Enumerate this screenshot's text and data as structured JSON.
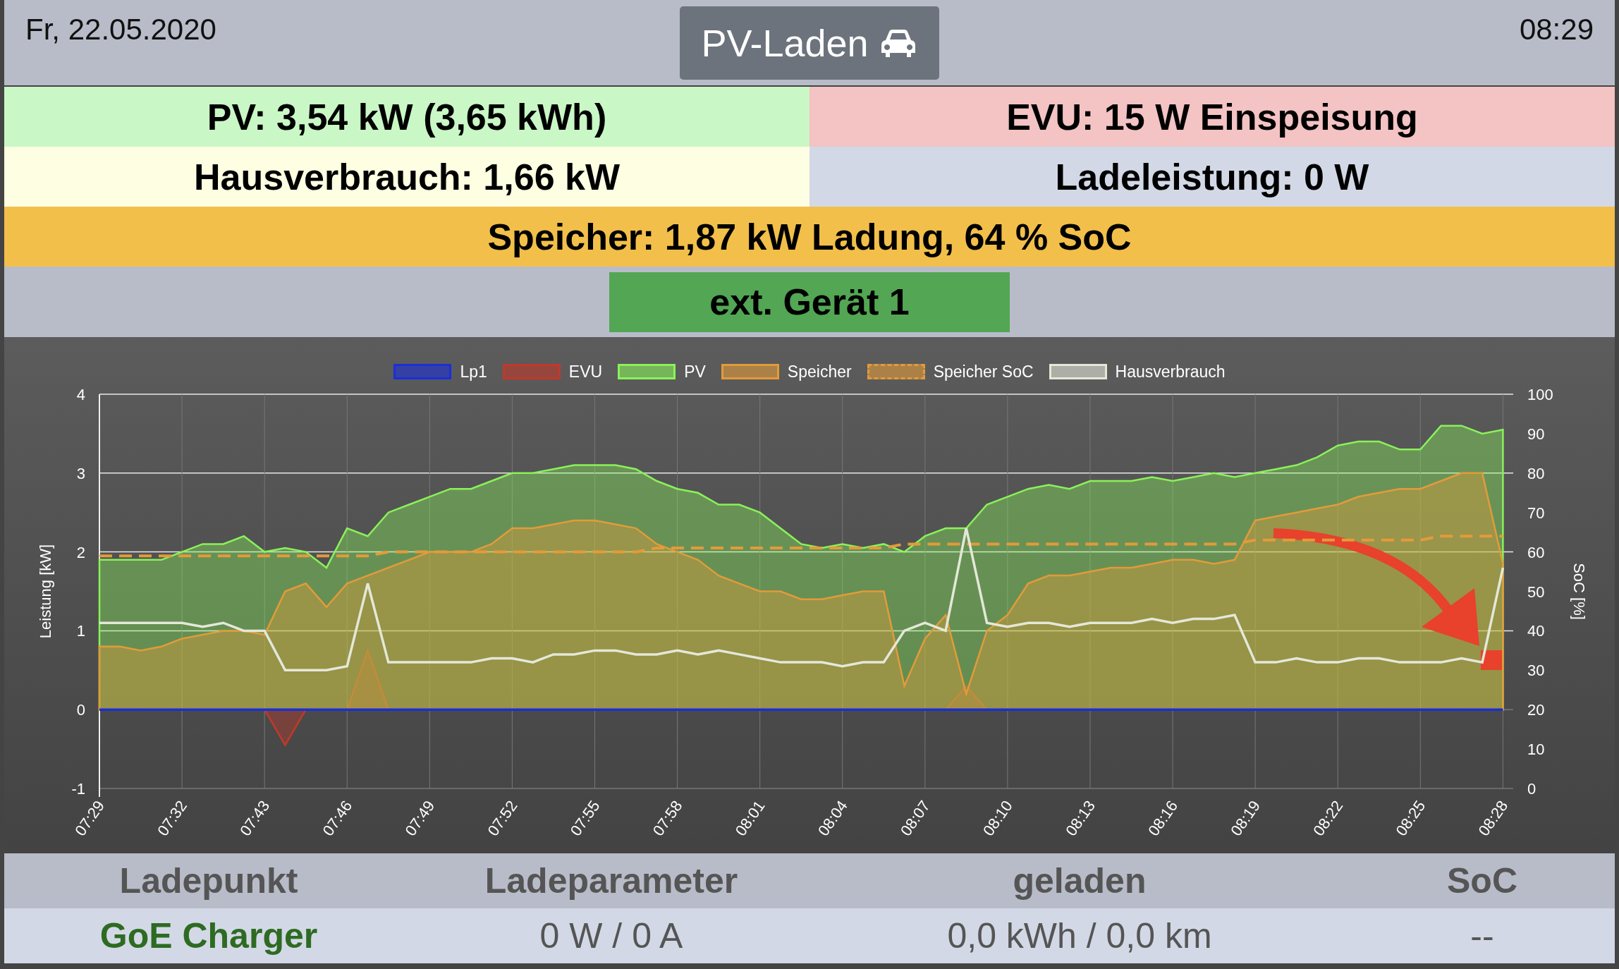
{
  "header": {
    "date": "Fr, 22.05.2020",
    "mode_button": {
      "label": "PV-Laden"
    },
    "time": "08:29"
  },
  "status_rows": [
    {
      "cells": [
        {
          "text": "PV: 3,54 kW (3,65 kWh)",
          "color": "#c9f7c5"
        },
        {
          "text": "EVU: 15 W Einspeisung",
          "color": "#f4c3c3"
        }
      ]
    },
    {
      "cells": [
        {
          "text": "Hausverbrauch: 1,66 kW",
          "color": "#fefee2"
        },
        {
          "text": "Ladeleistung: 0 W",
          "color": "#d3d8e6"
        }
      ]
    },
    {
      "cells": [
        {
          "text": "Speicher: 1,87 kW Ladung, 64 % SoC",
          "color": "#f2bf4a"
        }
      ]
    }
  ],
  "devices": [
    {
      "label": "ext. Gerät 1",
      "on": true
    }
  ],
  "chart": {
    "chart_data": {
      "type": "area",
      "grid": true,
      "legend": true,
      "ylabel": "Leistung [kW]",
      "y2label": "SoC [%]",
      "ylim": [
        -1,
        4
      ],
      "y2lim": [
        0,
        100
      ],
      "yticks": [
        -1,
        0,
        1,
        2,
        3,
        4
      ],
      "y2ticks": [
        0,
        10,
        20,
        30,
        40,
        50,
        60,
        70,
        80,
        90,
        100
      ],
      "categories": [
        "07:29",
        null,
        null,
        null,
        "07:32",
        null,
        null,
        null,
        "07:43",
        null,
        null,
        null,
        "07:46",
        null,
        null,
        null,
        "07:49",
        null,
        null,
        null,
        "07:52",
        null,
        null,
        null,
        "07:55",
        null,
        null,
        null,
        "07:58",
        null,
        null,
        null,
        "08:01",
        null,
        null,
        null,
        "08:04",
        null,
        null,
        null,
        "08:07",
        null,
        null,
        null,
        "08:10",
        null,
        null,
        null,
        "08:13",
        null,
        null,
        null,
        "08:16",
        null,
        null,
        null,
        "08:19",
        null,
        null,
        null,
        "08:22",
        null,
        null,
        null,
        "08:25",
        null,
        null,
        null,
        "08:28"
      ],
      "series": [
        {
          "name": "Lp1",
          "type": "line",
          "color": "#1a2fd6",
          "values": [
            0,
            0,
            0,
            0,
            0,
            0,
            0,
            0,
            0,
            0,
            0,
            0,
            0,
            0,
            0,
            0,
            0,
            0,
            0,
            0,
            0,
            0,
            0,
            0,
            0,
            0,
            0,
            0,
            0,
            0,
            0,
            0,
            0,
            0,
            0,
            0,
            0,
            0,
            0,
            0,
            0,
            0,
            0,
            0,
            0,
            0,
            0,
            0,
            0,
            0,
            0,
            0,
            0,
            0,
            0,
            0,
            0,
            0,
            0,
            0,
            0,
            0,
            0,
            0,
            0,
            0,
            0,
            0,
            0
          ]
        },
        {
          "name": "EVU",
          "type": "area",
          "color": "#c0392b",
          "values": [
            0,
            0,
            0,
            0,
            0,
            0,
            0,
            0,
            0,
            -0.45,
            0,
            0,
            0,
            0.75,
            0,
            0,
            0,
            0,
            0,
            0,
            0,
            0,
            0,
            0,
            0,
            0,
            0,
            0,
            0,
            0,
            0,
            0,
            0,
            0,
            0,
            0,
            0,
            0,
            0,
            0,
            0,
            0,
            0.3,
            0,
            0,
            0,
            0,
            0,
            0,
            0,
            0,
            0,
            0,
            0,
            0,
            0,
            0,
            0,
            0,
            0,
            0,
            0,
            0,
            0,
            0,
            0,
            0,
            0,
            0
          ]
        },
        {
          "name": "PV",
          "type": "area",
          "color": "#8af25a",
          "values": [
            1.9,
            1.9,
            1.9,
            1.9,
            2.0,
            2.1,
            2.1,
            2.2,
            2.0,
            2.05,
            2.0,
            1.8,
            2.3,
            2.2,
            2.5,
            2.6,
            2.7,
            2.8,
            2.8,
            2.9,
            3.0,
            3.0,
            3.05,
            3.1,
            3.1,
            3.1,
            3.05,
            2.9,
            2.8,
            2.75,
            2.6,
            2.6,
            2.5,
            2.3,
            2.1,
            2.05,
            2.1,
            2.05,
            2.1,
            2.0,
            2.2,
            2.3,
            2.3,
            2.6,
            2.7,
            2.8,
            2.85,
            2.8,
            2.9,
            2.9,
            2.9,
            2.95,
            2.9,
            2.95,
            3.0,
            2.95,
            3.0,
            3.05,
            3.1,
            3.2,
            3.35,
            3.4,
            3.4,
            3.3,
            3.3,
            3.6,
            3.6,
            3.5,
            3.55
          ]
        },
        {
          "name": "Speicher",
          "type": "area",
          "color": "#e39b3a",
          "values": [
            0.8,
            0.8,
            0.75,
            0.8,
            0.9,
            0.95,
            1.0,
            1.0,
            0.95,
            1.5,
            1.6,
            1.3,
            1.6,
            1.7,
            1.8,
            1.9,
            2.0,
            2.0,
            2.0,
            2.1,
            2.3,
            2.3,
            2.35,
            2.4,
            2.4,
            2.35,
            2.3,
            2.1,
            2.0,
            1.9,
            1.7,
            1.6,
            1.5,
            1.5,
            1.4,
            1.4,
            1.45,
            1.5,
            1.5,
            0.3,
            0.9,
            1.2,
            0.2,
            1.0,
            1.2,
            1.6,
            1.7,
            1.7,
            1.75,
            1.8,
            1.8,
            1.85,
            1.9,
            1.9,
            1.85,
            1.9,
            2.4,
            2.45,
            2.5,
            2.55,
            2.6,
            2.7,
            2.75,
            2.8,
            2.8,
            2.9,
            3.0,
            3.0,
            1.85
          ]
        },
        {
          "name": "Speicher SoC",
          "type": "line",
          "axis": "y2",
          "line_style": "dashed",
          "color": "#e39b3a",
          "values": [
            59,
            59,
            59,
            59,
            59,
            59,
            59,
            59,
            59,
            59,
            59,
            59,
            59,
            59,
            60,
            60,
            60,
            60,
            60,
            60,
            60,
            60,
            60,
            60,
            60,
            60,
            60,
            61,
            61,
            61,
            61,
            61,
            61,
            61,
            61,
            61,
            61,
            61,
            61,
            62,
            62,
            62,
            62,
            62,
            62,
            62,
            62,
            62,
            62,
            62,
            62,
            62,
            62,
            62,
            62,
            62,
            63,
            63,
            63,
            63,
            63,
            63,
            63,
            63,
            63,
            64,
            64,
            64,
            64
          ]
        },
        {
          "name": "Hausverbrauch",
          "type": "line",
          "color": "#e4e8d8",
          "values": [
            1.1,
            1.1,
            1.1,
            1.1,
            1.1,
            1.05,
            1.1,
            1.0,
            1.0,
            0.5,
            0.5,
            0.5,
            0.55,
            1.6,
            0.6,
            0.6,
            0.6,
            0.6,
            0.6,
            0.65,
            0.65,
            0.6,
            0.7,
            0.7,
            0.75,
            0.75,
            0.7,
            0.7,
            0.75,
            0.7,
            0.75,
            0.7,
            0.65,
            0.6,
            0.6,
            0.6,
            0.55,
            0.6,
            0.6,
            1.0,
            1.1,
            1.0,
            2.3,
            1.1,
            1.05,
            1.1,
            1.1,
            1.05,
            1.1,
            1.1,
            1.1,
            1.15,
            1.1,
            1.15,
            1.15,
            1.2,
            0.6,
            0.6,
            0.65,
            0.6,
            0.6,
            0.65,
            0.65,
            0.6,
            0.6,
            0.6,
            0.65,
            0.6,
            1.8
          ]
        }
      ]
    }
  },
  "table": {
    "columns": [
      "Ladepunkt",
      "Ladeparameter",
      "geladen",
      "SoC"
    ],
    "rows": [
      {
        "cells": [
          "GoE Charger",
          "0 W / 0 A",
          "0,0 kWh / 0,0 km",
          "--"
        ]
      }
    ]
  }
}
